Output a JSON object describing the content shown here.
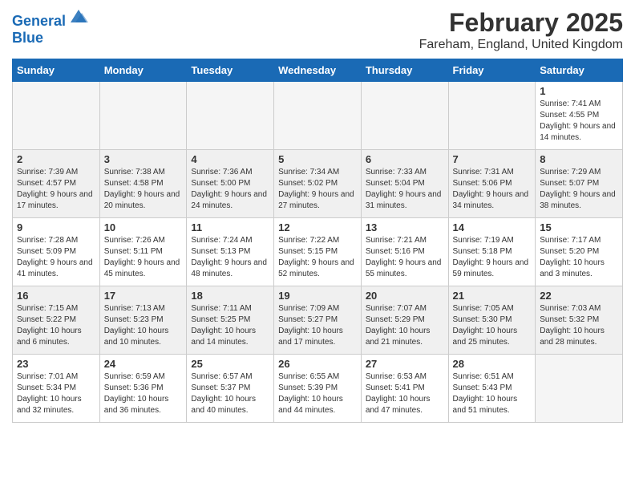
{
  "header": {
    "logo_text1": "General",
    "logo_text2": "Blue",
    "title": "February 2025",
    "subtitle": "Fareham, England, United Kingdom"
  },
  "days_of_week": [
    "Sunday",
    "Monday",
    "Tuesday",
    "Wednesday",
    "Thursday",
    "Friday",
    "Saturday"
  ],
  "weeks": [
    {
      "shade": false,
      "days": [
        {
          "num": "",
          "info": ""
        },
        {
          "num": "",
          "info": ""
        },
        {
          "num": "",
          "info": ""
        },
        {
          "num": "",
          "info": ""
        },
        {
          "num": "",
          "info": ""
        },
        {
          "num": "",
          "info": ""
        },
        {
          "num": "1",
          "info": "Sunrise: 7:41 AM\nSunset: 4:55 PM\nDaylight: 9 hours and 14 minutes."
        }
      ]
    },
    {
      "shade": true,
      "days": [
        {
          "num": "2",
          "info": "Sunrise: 7:39 AM\nSunset: 4:57 PM\nDaylight: 9 hours and 17 minutes."
        },
        {
          "num": "3",
          "info": "Sunrise: 7:38 AM\nSunset: 4:58 PM\nDaylight: 9 hours and 20 minutes."
        },
        {
          "num": "4",
          "info": "Sunrise: 7:36 AM\nSunset: 5:00 PM\nDaylight: 9 hours and 24 minutes."
        },
        {
          "num": "5",
          "info": "Sunrise: 7:34 AM\nSunset: 5:02 PM\nDaylight: 9 hours and 27 minutes."
        },
        {
          "num": "6",
          "info": "Sunrise: 7:33 AM\nSunset: 5:04 PM\nDaylight: 9 hours and 31 minutes."
        },
        {
          "num": "7",
          "info": "Sunrise: 7:31 AM\nSunset: 5:06 PM\nDaylight: 9 hours and 34 minutes."
        },
        {
          "num": "8",
          "info": "Sunrise: 7:29 AM\nSunset: 5:07 PM\nDaylight: 9 hours and 38 minutes."
        }
      ]
    },
    {
      "shade": false,
      "days": [
        {
          "num": "9",
          "info": "Sunrise: 7:28 AM\nSunset: 5:09 PM\nDaylight: 9 hours and 41 minutes."
        },
        {
          "num": "10",
          "info": "Sunrise: 7:26 AM\nSunset: 5:11 PM\nDaylight: 9 hours and 45 minutes."
        },
        {
          "num": "11",
          "info": "Sunrise: 7:24 AM\nSunset: 5:13 PM\nDaylight: 9 hours and 48 minutes."
        },
        {
          "num": "12",
          "info": "Sunrise: 7:22 AM\nSunset: 5:15 PM\nDaylight: 9 hours and 52 minutes."
        },
        {
          "num": "13",
          "info": "Sunrise: 7:21 AM\nSunset: 5:16 PM\nDaylight: 9 hours and 55 minutes."
        },
        {
          "num": "14",
          "info": "Sunrise: 7:19 AM\nSunset: 5:18 PM\nDaylight: 9 hours and 59 minutes."
        },
        {
          "num": "15",
          "info": "Sunrise: 7:17 AM\nSunset: 5:20 PM\nDaylight: 10 hours and 3 minutes."
        }
      ]
    },
    {
      "shade": true,
      "days": [
        {
          "num": "16",
          "info": "Sunrise: 7:15 AM\nSunset: 5:22 PM\nDaylight: 10 hours and 6 minutes."
        },
        {
          "num": "17",
          "info": "Sunrise: 7:13 AM\nSunset: 5:23 PM\nDaylight: 10 hours and 10 minutes."
        },
        {
          "num": "18",
          "info": "Sunrise: 7:11 AM\nSunset: 5:25 PM\nDaylight: 10 hours and 14 minutes."
        },
        {
          "num": "19",
          "info": "Sunrise: 7:09 AM\nSunset: 5:27 PM\nDaylight: 10 hours and 17 minutes."
        },
        {
          "num": "20",
          "info": "Sunrise: 7:07 AM\nSunset: 5:29 PM\nDaylight: 10 hours and 21 minutes."
        },
        {
          "num": "21",
          "info": "Sunrise: 7:05 AM\nSunset: 5:30 PM\nDaylight: 10 hours and 25 minutes."
        },
        {
          "num": "22",
          "info": "Sunrise: 7:03 AM\nSunset: 5:32 PM\nDaylight: 10 hours and 28 minutes."
        }
      ]
    },
    {
      "shade": false,
      "days": [
        {
          "num": "23",
          "info": "Sunrise: 7:01 AM\nSunset: 5:34 PM\nDaylight: 10 hours and 32 minutes."
        },
        {
          "num": "24",
          "info": "Sunrise: 6:59 AM\nSunset: 5:36 PM\nDaylight: 10 hours and 36 minutes."
        },
        {
          "num": "25",
          "info": "Sunrise: 6:57 AM\nSunset: 5:37 PM\nDaylight: 10 hours and 40 minutes."
        },
        {
          "num": "26",
          "info": "Sunrise: 6:55 AM\nSunset: 5:39 PM\nDaylight: 10 hours and 44 minutes."
        },
        {
          "num": "27",
          "info": "Sunrise: 6:53 AM\nSunset: 5:41 PM\nDaylight: 10 hours and 47 minutes."
        },
        {
          "num": "28",
          "info": "Sunrise: 6:51 AM\nSunset: 5:43 PM\nDaylight: 10 hours and 51 minutes."
        },
        {
          "num": "",
          "info": ""
        }
      ]
    }
  ]
}
